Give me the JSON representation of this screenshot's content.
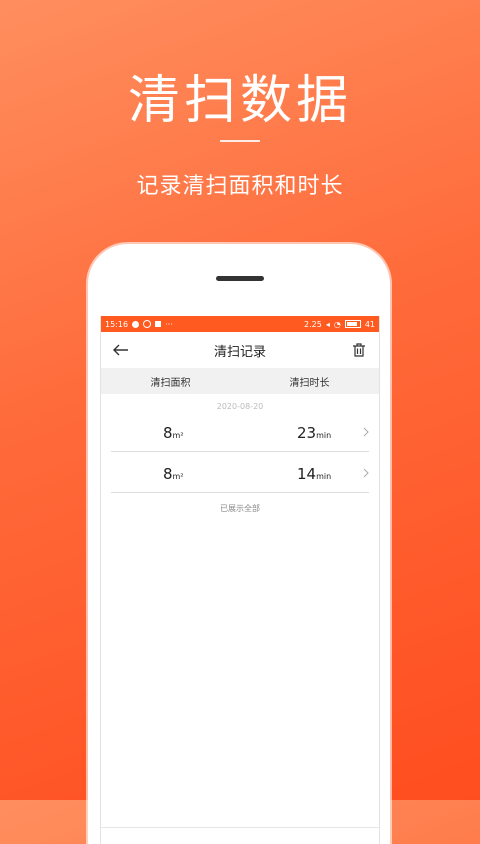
{
  "hero": {
    "title": "清扫数据",
    "subtitle": "记录清扫面积和时长"
  },
  "statusbar": {
    "time": "15:16",
    "speed": "2.25",
    "battery": "41"
  },
  "navbar": {
    "title": "清扫记录"
  },
  "table": {
    "headers": [
      "清扫面积",
      "清扫时长"
    ],
    "date": "2020-08-20",
    "records": [
      {
        "area": "8",
        "area_unit": "m²",
        "time": "23",
        "time_unit": "min"
      },
      {
        "area": "8",
        "area_unit": "m²",
        "time": "14",
        "time_unit": "min"
      }
    ],
    "footer": "已展示全部"
  },
  "colors": {
    "accent": "#ff5a1f",
    "background_start": "#ff8e5e",
    "background_end": "#ff4d1f"
  },
  "icons": [
    "back-arrow-icon",
    "trash-icon",
    "chevron-right-icon"
  ]
}
